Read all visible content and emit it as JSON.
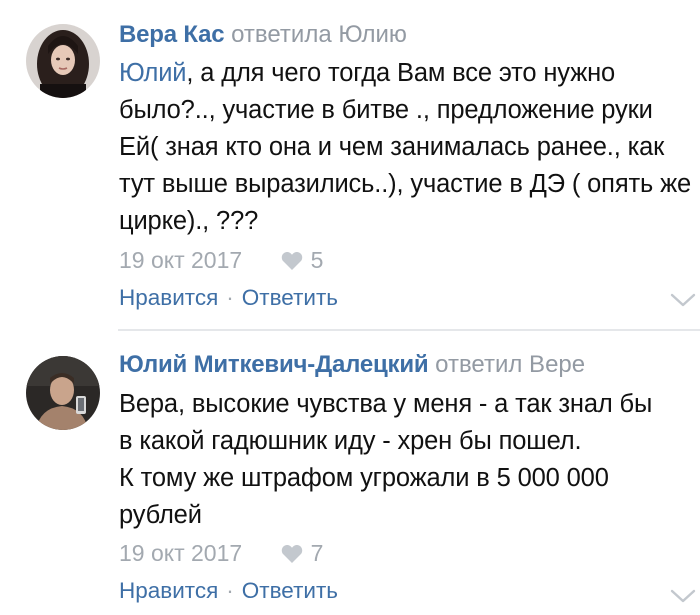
{
  "comments": [
    {
      "author": "Вера Кас",
      "reply_note": "ответила Юлию",
      "mention": "Юлий",
      "text_after_mention": ", а для чего тогда Вам все это нужно было?.., участие в битве ., предложение руки Ей( зная кто она и чем занималась ранее., как тут выше выразились..), участие в ДЭ ( опять же цирке)., ???",
      "date": "19 окт 2017",
      "likes": "5",
      "like_label": "Нравится",
      "separator": "·",
      "reply_label": "Ответить",
      "avatar_icon": "user-avatar-woman"
    },
    {
      "author": "Юлий Миткевич-Далецкий",
      "reply_note": "ответил Вере",
      "text_lines": [
        "Вера, высокие чувства у меня - а так знал бы",
        "в какой гадюшник иду - хрен бы пошел.",
        "К тому же штрафом угрожали в 5 000 000",
        "рублей"
      ],
      "date": "19 окт 2017",
      "likes": "7",
      "like_label": "Нравится",
      "separator": "·",
      "reply_label": "Ответить",
      "avatar_icon": "user-avatar-man"
    }
  ],
  "colors": {
    "link": "#3e6fa6",
    "muted": "#939aa3",
    "text": "#111111",
    "divider": "#e5e7ea"
  }
}
